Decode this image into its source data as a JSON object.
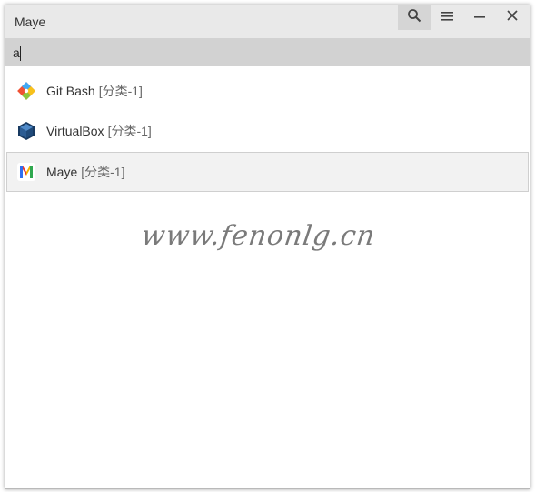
{
  "window": {
    "title": "Maye"
  },
  "titlebar": {
    "buttons": [
      {
        "icon": "search-icon"
      },
      {
        "icon": "hamburger-menu-icon"
      },
      {
        "icon": "minimize-icon"
      },
      {
        "icon": "close-icon"
      }
    ]
  },
  "search": {
    "value": "a",
    "placeholder": ""
  },
  "results": [
    {
      "name": "Git Bash",
      "category": "[分类-1]",
      "icon": "git-bash-icon",
      "selected": false
    },
    {
      "name": "VirtualBox",
      "category": "[分类-1]",
      "icon": "virtualbox-icon",
      "selected": false
    },
    {
      "name": "Maye",
      "category": "[分类-1]",
      "icon": "maye-icon",
      "selected": true
    }
  ],
  "watermark": "www.fenonlg.cn",
  "colors": {
    "titlebar": "#e9e9e9",
    "searchbar": "#d2d2d2",
    "selected_row": "#f2f2f2",
    "maye_icon_blue": "#2f6ff0",
    "maye_icon_red": "#e53935",
    "maye_icon_yellow": "#f5b400"
  }
}
